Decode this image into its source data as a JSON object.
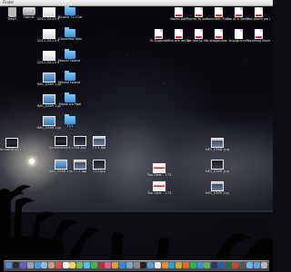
{
  "menubar": {
    "title": "Finder"
  },
  "desktop_icons": [
    {
      "id": "trash",
      "label": "Trash",
      "glyph": "trash-can-icon",
      "kind": "can"
    },
    {
      "id": "hamik",
      "label": "Hamik",
      "glyph": "hard-drive-icon",
      "kind": "disk"
    },
    {
      "id": "img1",
      "label": "2011-03-25 9 .31 ...jpg",
      "glyph": "photo-icon",
      "kind": "p-white"
    },
    {
      "id": "blunch",
      "label": "Blunch T1 Cheatsh",
      "glyph": "folder-icon",
      "kind": "folder"
    },
    {
      "id": "img2",
      "label": "2011-03-25 9 .31 ...jpg",
      "glyph": "photo-icon",
      "kind": "p-white"
    },
    {
      "id": "classified",
      "label": "Classified Hood ...",
      "glyph": "folder-icon",
      "kind": "folder"
    },
    {
      "id": "img3",
      "label": "2011-03-25 9 .31 ...jpg",
      "glyph": "photo-icon",
      "kind": "p-white"
    },
    {
      "id": "maverl",
      "label": "Maverl Island T1",
      "glyph": "folder-icon",
      "kind": "folder"
    },
    {
      "id": "img_mid",
      "label": "IMG_0369 1.jpg",
      "glyph": "photo-icon",
      "kind": "p-blue"
    },
    {
      "id": "maverl2",
      "label": "Maverl Island T1 2",
      "glyph": "folder-icon",
      "kind": "folder"
    },
    {
      "id": "img_0369",
      "label": "IMG_0369 1.jpg",
      "glyph": "photo-icon",
      "kind": "p-blue"
    },
    {
      "id": "maverl3",
      "label": "Maverick Pool",
      "glyph": "folder-icon",
      "kind": "folder"
    },
    {
      "id": "img_0368",
      "label": "IMG_0368 1.jpg",
      "glyph": "photo-icon",
      "kind": "p-blue"
    },
    {
      "id": "t11",
      "label": "T11",
      "glyph": "folder-icon",
      "kind": "folder"
    },
    {
      "id": "notes",
      "label": "Notes.pdf",
      "glyph": "pdf-document-icon",
      "kind": "pdf"
    },
    {
      "id": "places",
      "label": "Places to see.pdf",
      "glyph": "pdf-document-icon",
      "kind": "pdf"
    },
    {
      "id": "scientific",
      "label": "Scientific Processin...",
      "glyph": "pdf-document-icon",
      "kind": "pdf"
    },
    {
      "id": "topof",
      "label": "Top of a Vertical.pdf",
      "glyph": "pdf-document-icon",
      "kind": "pdf"
    },
    {
      "id": "theworld",
      "label": "The world we live in",
      "glyph": "pdf-document-icon",
      "kind": "pdf"
    },
    {
      "id": "toexplore",
      "label": "To Explore",
      "glyph": "pdf-document-icon",
      "kind": "pdf"
    },
    {
      "id": "who",
      "label": "Who are we leave_doc",
      "glyph": "pdf-document-icon",
      "kind": "pdf"
    },
    {
      "id": "wesee",
      "label": "We see to life.pdf",
      "glyph": "pdf-document-icon",
      "kind": "pdf"
    },
    {
      "id": "happiness",
      "label": "Happiness",
      "glyph": "pdf-document-icon",
      "kind": "pdf"
    },
    {
      "id": "thought",
      "label": "thought.txt",
      "glyph": "document-icon",
      "kind": "doc"
    },
    {
      "id": "traveling",
      "label": "Traveling Bucket list",
      "glyph": "pdf-document-icon",
      "kind": "pdf"
    },
    {
      "id": "screenshot",
      "label": "Screenshot 5.jpg",
      "glyph": "photo-icon",
      "kind": "p-night"
    },
    {
      "id": "ssl",
      "label": "SSL.jpg",
      "glyph": "photo-icon",
      "kind": "p-dark"
    },
    {
      "id": "t1",
      "label": "T1 1.jpg",
      "glyph": "photo-icon",
      "kind": "p-screen"
    },
    {
      "id": "img_bl",
      "label": "IMG_0368 1.jpg",
      "glyph": "photo-icon",
      "kind": "p-blue"
    },
    {
      "id": "t1b",
      "label": "T1 2.jpg",
      "glyph": "photo-icon",
      "kind": "p-screen"
    },
    {
      "id": "t13",
      "label": "T13.jpg",
      "glyph": "photo-icon",
      "kind": "p-dark"
    },
    {
      "id": "topgear1",
      "label": "Top Gear - 1734_ Carr",
      "glyph": "video-icon",
      "kind": "p-red"
    },
    {
      "id": "topgear2",
      "label": "Top Gear - 1734_ Carr",
      "glyph": "video-icon",
      "kind": "p-red"
    },
    {
      "id": "img_r1",
      "label": "IMG_0368 .jpg",
      "glyph": "photo-icon",
      "kind": "p-screen"
    },
    {
      "id": "img_r2",
      "label": "IMG_0369 .jpg",
      "glyph": "photo-icon",
      "kind": "p-dark"
    },
    {
      "id": "img_r3",
      "label": "IMG_0369 1.jpg",
      "glyph": "photo-icon",
      "kind": "p-screen"
    },
    {
      "id": "left_pic",
      "label": "Screenshot 1 9.jpg",
      "glyph": "photo-icon",
      "kind": "p-night"
    }
  ],
  "dock": {
    "items": [
      {
        "name": "finder",
        "color": "#4a90d9"
      },
      {
        "name": "dashboard",
        "color": "#2c2c2c"
      },
      {
        "name": "mission-control",
        "color": "#6a5acd"
      },
      {
        "name": "launchpad",
        "color": "#9aa3b0"
      },
      {
        "name": "safari",
        "color": "#3aa0e8"
      },
      {
        "name": "mail",
        "color": "#8fb8e8"
      },
      {
        "name": "contacts",
        "color": "#c8a070"
      },
      {
        "name": "calendar",
        "color": "#e84a4a"
      },
      {
        "name": "reminders",
        "color": "#f0f0f0"
      },
      {
        "name": "notes",
        "color": "#f2d55a"
      },
      {
        "name": "maps",
        "color": "#6cbf5a"
      },
      {
        "name": "messages",
        "color": "#4fc3f7"
      },
      {
        "name": "facetime",
        "color": "#3dbb4b"
      },
      {
        "name": "photo-booth",
        "color": "#b0342f"
      },
      {
        "name": "itunes",
        "color": "#e35a9a"
      },
      {
        "name": "ibooks",
        "color": "#f09a2a"
      },
      {
        "name": "app-store",
        "color": "#2e8be6"
      },
      {
        "name": "preview",
        "color": "#7fa7d6"
      },
      {
        "name": "system-preferences",
        "color": "#8a8a8a"
      },
      {
        "name": "terminal",
        "color": "#222"
      },
      {
        "name": "xcode",
        "color": "#4aa0e0"
      },
      {
        "name": "textedit",
        "color": "#e8e8e8"
      },
      {
        "name": "vlc",
        "color": "#f08a1a"
      },
      {
        "name": "skype",
        "color": "#12a5f4"
      },
      {
        "name": "chrome",
        "color": "#e3a21a"
      },
      {
        "name": "firefox",
        "color": "#e06b1a"
      },
      {
        "name": "spotify",
        "color": "#1db954"
      },
      {
        "name": "dropbox",
        "color": "#3d8be6"
      },
      {
        "name": "evernote",
        "color": "#5bb544"
      },
      {
        "name": "photoshop",
        "color": "#1f3b66"
      },
      {
        "name": "word",
        "color": "#2b5da8"
      },
      {
        "name": "excel",
        "color": "#207245"
      },
      {
        "name": "powerpoint",
        "color": "#c84a2a"
      },
      {
        "name": "calculator",
        "color": "#555"
      },
      {
        "name": "utilities-folder",
        "color": "#6fb7ea"
      },
      {
        "name": "downloads-folder",
        "color": "#5aa6e2"
      },
      {
        "name": "trash",
        "color": "#b8b8b8"
      }
    ]
  }
}
